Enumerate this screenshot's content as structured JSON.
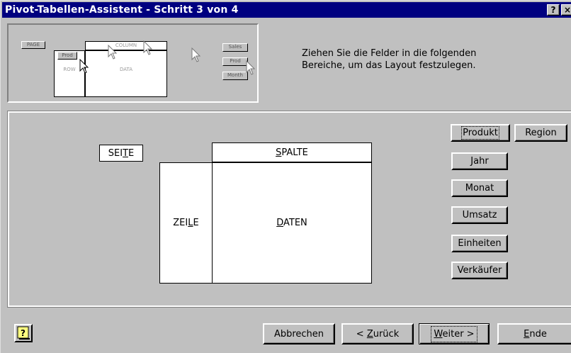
{
  "window": {
    "title": "Pivot-Tabellen-Assistent - Schritt 3 von 4",
    "help_glyph": "?",
    "close_glyph": "×"
  },
  "preview": {
    "page_label": "PAGE",
    "column_label": "COLUMN",
    "row_label": "ROW",
    "data_label": "DATA",
    "prod_label": "Prod",
    "sales_label": "Sales",
    "prod2_label": "Prod",
    "month_label": "Month"
  },
  "instructions": {
    "line1": "Ziehen Sie die Felder in die folgenden",
    "line2": "Bereiche, um das Layout festzulegen."
  },
  "areas": {
    "page": {
      "before": "SEI",
      "mnemonic": "T",
      "after": "E"
    },
    "column": {
      "before": "",
      "mnemonic": "S",
      "after": "PALTE"
    },
    "row": {
      "before": "ZEI",
      "mnemonic": "L",
      "after": "E"
    },
    "data": {
      "before": "",
      "mnemonic": "D",
      "after": "ATEN"
    }
  },
  "fields": [
    "Produkt",
    "Region",
    "Jahr",
    "Monat",
    "Umsatz",
    "Einheiten",
    "Verkäufer"
  ],
  "buttons": {
    "cancel": "Abbrechen",
    "back": {
      "before": "< ",
      "mnemonic": "Z",
      "after": "urück"
    },
    "next": {
      "before": "",
      "mnemonic": "W",
      "after": "eiter >"
    },
    "finish": {
      "before": "",
      "mnemonic": "E",
      "after": "nde"
    }
  },
  "icons": {
    "help": "help-icon",
    "cursor": "arrow-cursor-icon"
  },
  "colors": {
    "titlebar": "#000080",
    "face": "#c0c0c0"
  }
}
